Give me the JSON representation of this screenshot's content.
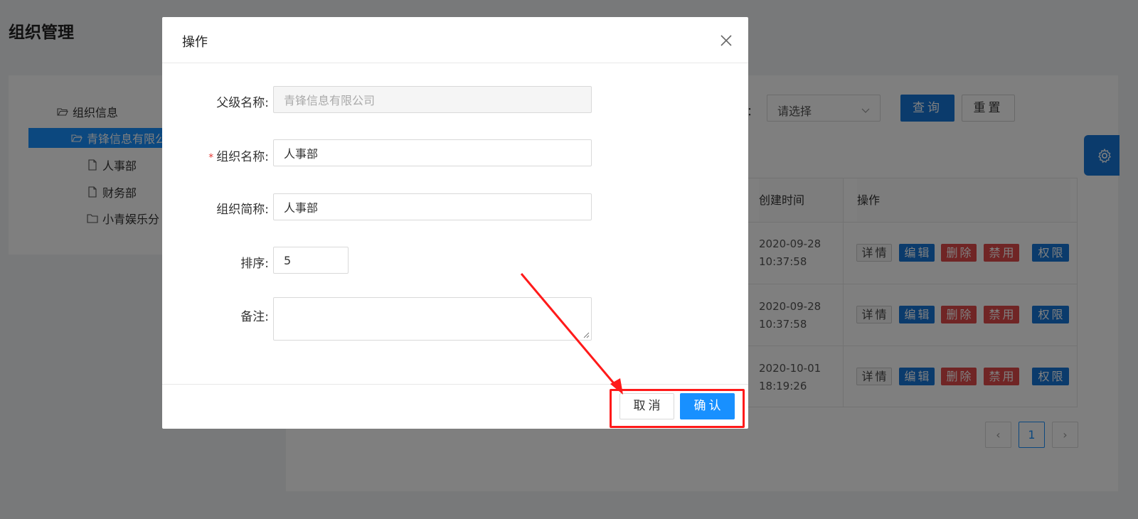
{
  "page": {
    "title": "组织管理"
  },
  "tree": {
    "root": "组织信息",
    "selected": "青锋信息有限公",
    "children": [
      "人事部",
      "财务部",
      "小青娱乐分"
    ]
  },
  "filters": {
    "label_tail": "：",
    "select_value": "请选择",
    "query_label": "查询",
    "reset_label": "重置"
  },
  "table": {
    "headers": {
      "created_time": "创建时间",
      "operation": "操作"
    },
    "rows": [
      {
        "time_date": "2020-09-28",
        "time_clock": "10:37:58"
      },
      {
        "time_date": "2020-09-28",
        "time_clock": "10:37:58"
      },
      {
        "time_date": "2020-10-01",
        "time_clock": "18:19:26"
      }
    ],
    "op_labels": {
      "detail": "详情",
      "edit": "编辑",
      "delete": "删除",
      "disable": "禁用",
      "permission": "权限"
    }
  },
  "pagination": {
    "prev": "‹",
    "current": "1",
    "next": "›"
  },
  "modal": {
    "title": "操作",
    "fields": {
      "parent_name_label": "父级名称:",
      "parent_name_value": "青锋信息有限公司",
      "org_name_label": "组织名称:",
      "org_name_required": "*",
      "org_name_value": "人事部",
      "org_short_label": "组织简称:",
      "org_short_value": "人事部",
      "sort_label": "排序:",
      "sort_value": "5",
      "remark_label": "备注:",
      "remark_value": ""
    },
    "cancel_label": "取消",
    "confirm_label": "确认"
  },
  "colors": {
    "primary": "#1890ff",
    "danger": "#e04a4a",
    "annotation": "#ff1a1a"
  },
  "icons": [
    "folder-open-icon",
    "file-icon",
    "folder-icon",
    "chevron-down-icon",
    "gear-icon",
    "close-icon"
  ]
}
